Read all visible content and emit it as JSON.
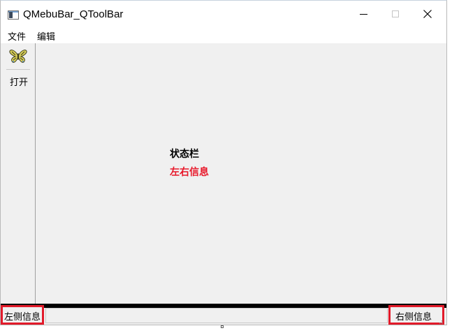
{
  "window": {
    "title": "QMebuBar_QToolBar"
  },
  "menubar": {
    "items": [
      {
        "label": "文件"
      },
      {
        "label": "编辑"
      }
    ]
  },
  "toolbar": {
    "open_label": "打开",
    "open_icon": "butterfly-icon"
  },
  "central": {
    "status_title": "状态栏",
    "info_text": "左右信息",
    "info_color": "#e8182a"
  },
  "statusbar": {
    "left_text": "左侧信息",
    "right_text": "右侧信息",
    "highlight_color": "#e21a2a"
  }
}
